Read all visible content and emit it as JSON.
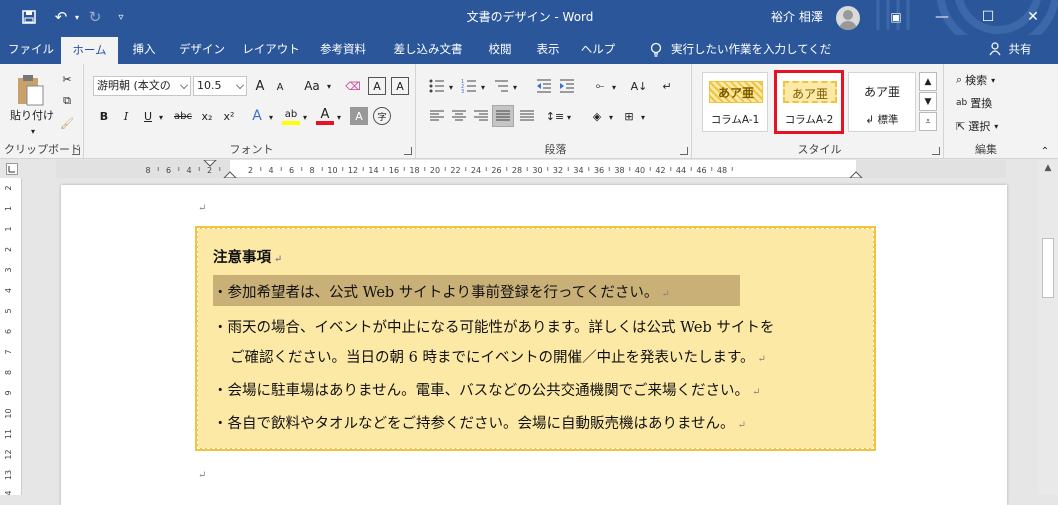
{
  "window": {
    "title": "文書のデザイン - Word",
    "user": "裕介 相澤"
  },
  "tabs": [
    "ファイル",
    "ホーム",
    "挿入",
    "デザイン",
    "レイアウト",
    "参考資料",
    "差し込み文書",
    "校閲",
    "表示",
    "ヘルプ"
  ],
  "tell_me": "実行したい作業を入力してください",
  "share": "共有",
  "clipboard": {
    "paste": "貼り付け",
    "label": "クリップボード"
  },
  "font": {
    "name": "游明朝 (本文の",
    "size": "10.5",
    "case": "Aa",
    "label": "フォント",
    "bold": "B",
    "italic": "I",
    "underline": "U",
    "strike": "abc",
    "sub": "x₂",
    "sup": "x²",
    "grow": "A",
    "shrink": "A",
    "color_a": "A",
    "shade_a": "A",
    "enclose": "字"
  },
  "paragraph": {
    "label": "段落"
  },
  "styles": {
    "label": "スタイル",
    "sample": "あア亜",
    "items": [
      {
        "name": "コラムA-1"
      },
      {
        "name": "コラムA-2"
      },
      {
        "name": "↲ 標準"
      }
    ]
  },
  "editing": {
    "label": "編集",
    "find": "検索",
    "replace": "置換",
    "select": "選択"
  },
  "colors": {
    "ribbon_blue": "#2b579a",
    "column_bg": "#fde9a6",
    "column_border": "#f0c43f",
    "highlight_red": "#e81123"
  },
  "ruler": {
    "h_labels": [
      "8",
      "6",
      "4",
      "2",
      "2",
      "4",
      "6",
      "8",
      "10",
      "12",
      "14",
      "16",
      "18",
      "20",
      "22",
      "24",
      "26",
      "28",
      "30",
      "32",
      "34",
      "36",
      "38",
      "40",
      "42",
      "44",
      "46",
      "48"
    ],
    "v_labels": [
      "2",
      "1",
      "1",
      "2",
      "3",
      "4",
      "5",
      "6",
      "7",
      "8",
      "9",
      "10",
      "11",
      "12",
      "13",
      "14"
    ]
  },
  "document": {
    "heading": "注意事項",
    "lines": [
      "・参加希望者は、公式 Web サイトより事前登録を行ってください。",
      "・雨天の場合、イベントが中止になる可能性があります。詳しくは公式 Web サイトを",
      "ご確認ください。当日の朝 6 時までにイベントの開催／中止を発表いたします。",
      "・会場に駐車場はありません。電車、バスなどの公共交通機関でご来場ください。",
      "・各自で飲料やタオルなどをご持参ください。会場に自動販売機はありません。"
    ],
    "para_mark": "↵"
  }
}
